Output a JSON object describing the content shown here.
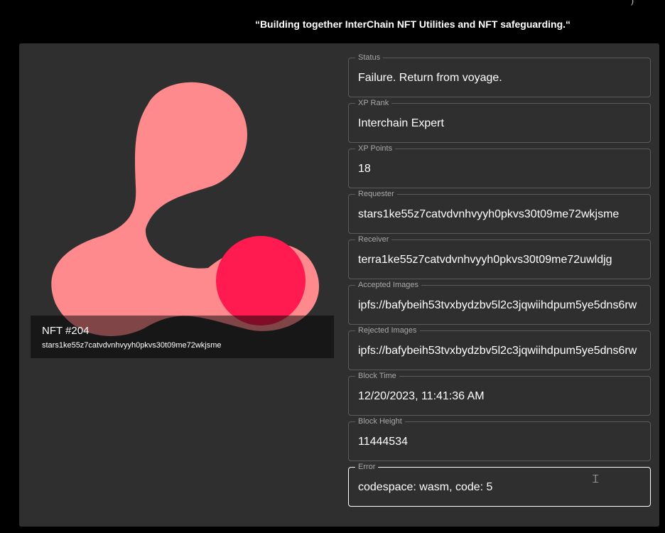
{
  "header": {
    "tagline": "“Building together InterChain NFT Utilities and NFT safeguarding.“",
    "corner_mark": ")"
  },
  "nft": {
    "title": "NFT #204",
    "owner": "stars1ke55z7catvdvnhvyyh0pkvs30t09me72wkjsme",
    "colors": {
      "blob": "#ff8a8e",
      "circle": "#ff1a4f"
    }
  },
  "fields": [
    {
      "label": "Status",
      "value": "Failure. Return from voyage."
    },
    {
      "label": "XP Rank",
      "value": "Interchain Expert"
    },
    {
      "label": "XP Points",
      "value": "18"
    },
    {
      "label": "Requester",
      "value": "stars1ke55z7catvdvnhvyyh0pkvs30t09me72wkjsme"
    },
    {
      "label": "Receiver",
      "value": "terra1ke55z7catvdvnhvyyh0pkvs30t09me72uwldjg"
    },
    {
      "label": "Accepted Images",
      "value": "ipfs://bafybeih53tvxbydzbv5l2c3jqwiihdpum5ye5dns6rw"
    },
    {
      "label": "Rejected Images",
      "value": "ipfs://bafybeih53tvxbydzbv5l2c3jqwiihdpum5ye5dns6rw"
    },
    {
      "label": "Block Time",
      "value": "12/20/2023, 11:41:36 AM"
    },
    {
      "label": "Block Height",
      "value": "11444534"
    },
    {
      "label": "Error",
      "value": "codespace: wasm, code: 5"
    }
  ],
  "icons": {
    "text_cursor": "text-cursor-icon"
  }
}
